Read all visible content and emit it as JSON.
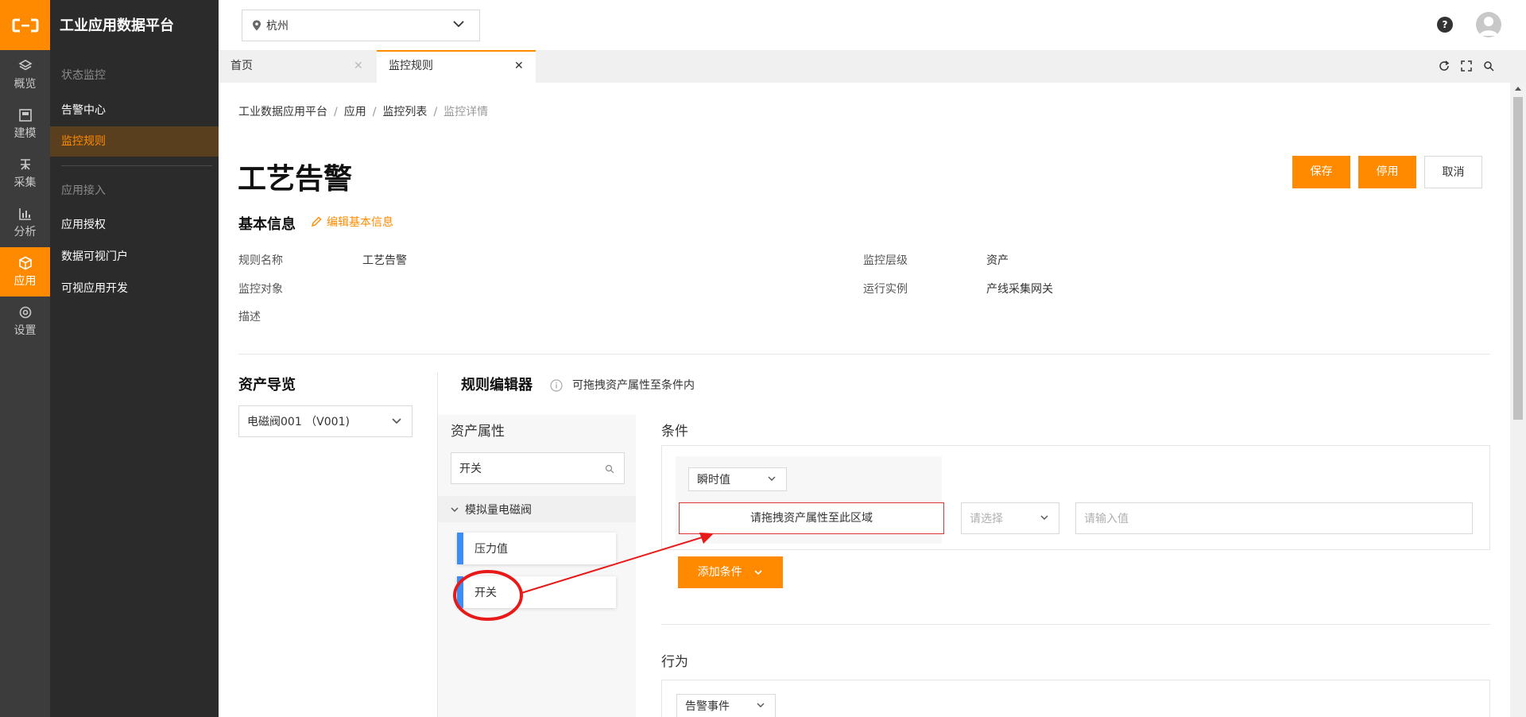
{
  "app": {
    "brand": "工业应用数据平台"
  },
  "rail": {
    "items": [
      {
        "label": "概览",
        "icon": "layers-icon"
      },
      {
        "label": "建模",
        "icon": "model-icon"
      },
      {
        "label": "采集",
        "icon": "collect-icon"
      },
      {
        "label": "分析",
        "icon": "chart-icon"
      },
      {
        "label": "应用",
        "icon": "cube-icon",
        "active": true
      },
      {
        "label": "设置",
        "icon": "gear-icon"
      }
    ]
  },
  "subnav": {
    "group1": "状态监控",
    "item_alarm": "告警中心",
    "item_rules": "监控规则",
    "group2": "应用接入",
    "item_auth": "应用授权",
    "item_portal": "数据可视门户",
    "item_dev": "可视应用开发"
  },
  "header": {
    "city": "杭州",
    "help": "?"
  },
  "tabs": [
    {
      "label": "首页"
    },
    {
      "label": "监控规则",
      "active": true
    }
  ],
  "breadcrumb": [
    "工业数据应用平台",
    "应用",
    "监控列表",
    "监控详情"
  ],
  "page": {
    "title": "工艺告警",
    "save": "保存",
    "disable": "停用",
    "cancel": "取消"
  },
  "basic": {
    "title": "基本信息",
    "edit": "编辑基本信息",
    "rule_name_label": "规则名称",
    "rule_name": "工艺告警",
    "monitor_obj_label": "监控对象",
    "desc_label": "描述",
    "level_label": "监控层级",
    "level": "资产",
    "instance_label": "运行实例",
    "instance": "产线采集网关"
  },
  "asset_nav": {
    "title": "资产导览",
    "selected": "电磁阀001 （V001)"
  },
  "editor": {
    "title": "规则编辑器",
    "hint": "可拖拽资产属性至条件内",
    "props_title": "资产属性",
    "search_value": "开关",
    "tree_group": "模拟量电磁阀",
    "prop1": "压力值",
    "prop2": "开关",
    "condition_title": "条件",
    "value_type": "瞬时值",
    "drop_text": "请拖拽资产属性至此区域",
    "op_placeholder": "请选择",
    "input_placeholder": "请输入值",
    "add_condition": "添加条件",
    "action_title": "行为",
    "action_type": "告警事件"
  },
  "colors": {
    "accent": "#ff8a00",
    "annotation": "#e81919",
    "prop_bar": "#3a8ef6"
  }
}
